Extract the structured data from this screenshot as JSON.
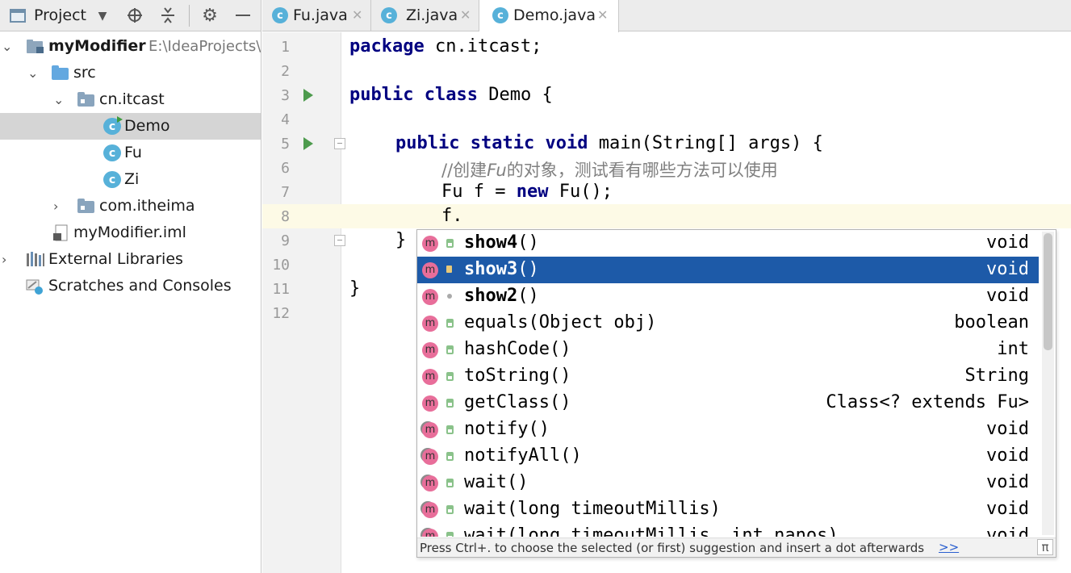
{
  "project_panel": {
    "title": "Project",
    "header_icons": [
      "project-view-icon",
      "dropdown-arrow-icon",
      "locate-icon",
      "collapse-icon",
      "gear-icon",
      "minimize-icon"
    ],
    "tree": {
      "root_name": "myModifier",
      "root_path": "E:\\IdeaProjects\\",
      "src": "src",
      "pkg1": "cn.itcast",
      "demo": "Demo",
      "fu": "Fu",
      "zi": "Zi",
      "pkg2": "com.itheima",
      "iml": "myModifier.iml",
      "external": "External Libraries",
      "scratches": "Scratches and Consoles"
    }
  },
  "editor_tabs": [
    {
      "label": "Fu.java",
      "active": false
    },
    {
      "label": "Zi.java",
      "active": false
    },
    {
      "label": "Demo.java",
      "active": true
    }
  ],
  "editor": {
    "line_numbers": [
      "1",
      "2",
      "3",
      "4",
      "5",
      "6",
      "7",
      "8",
      "9",
      "10",
      "11",
      "12"
    ],
    "caret_line": 8,
    "code": {
      "l1_kw": "package",
      "l1_rest": " cn.itcast;",
      "l3_kw1": "public",
      "l3_kw2": "class",
      "l3_rest": " Demo {",
      "l5_kw1": "public",
      "l5_kw2": "static",
      "l5_kw3": "void",
      "l5_rest": " main(String[] args) {",
      "l6_c1": "//创建",
      "l6_c2": "Fu",
      "l6_c3": "的对象，测试看有哪些方法可以使用",
      "l7_a": "Fu f = ",
      "l7_kw": "new",
      "l7_b": " Fu();",
      "l8": "f.",
      "l9": "}",
      "l11": "}"
    }
  },
  "completion": {
    "items": [
      {
        "bold": "show4",
        "rest": "()",
        "type": "void",
        "visibility": "public",
        "inherited": false
      },
      {
        "bold": "show3",
        "rest": "()",
        "type": "void",
        "visibility": "protected",
        "inherited": false
      },
      {
        "bold": "show2",
        "rest": "()",
        "type": "void",
        "visibility": "package",
        "inherited": false
      },
      {
        "bold": "",
        "rest": "equals(Object obj)",
        "type": "boolean",
        "visibility": "public",
        "inherited": false
      },
      {
        "bold": "",
        "rest": "hashCode()",
        "type": "int",
        "visibility": "public",
        "inherited": false
      },
      {
        "bold": "",
        "rest": "toString()",
        "type": "String",
        "visibility": "public",
        "inherited": false
      },
      {
        "bold": "",
        "rest": "getClass()",
        "type": "Class<? extends Fu>",
        "visibility": "public",
        "inherited": false
      },
      {
        "bold": "",
        "rest": "notify()",
        "type": "void",
        "visibility": "public",
        "inherited": true
      },
      {
        "bold": "",
        "rest": "notifyAll()",
        "type": "void",
        "visibility": "public",
        "inherited": true
      },
      {
        "bold": "",
        "rest": "wait()",
        "type": "void",
        "visibility": "public",
        "inherited": true
      },
      {
        "bold": "",
        "rest": "wait(long timeoutMillis)",
        "type": "void",
        "visibility": "public",
        "inherited": true
      },
      {
        "bold": "",
        "rest": "wait(long timeoutMillis, int nanos)",
        "type": "void",
        "visibility": "public",
        "inherited": true
      }
    ],
    "selected_index": 1,
    "method_icon_letter": "m",
    "hint": "Press Ctrl+. to choose the selected (or first) suggestion and insert a dot afterwards",
    "more_link": ">>",
    "pi_symbol": "π"
  },
  "colors": {
    "selection": "#1d5aa8",
    "keyword": "#000080",
    "comment": "#808080",
    "method_icon": "#e86e9a",
    "class_icon": "#57b1d9",
    "caret_line": "#fdfae6"
  }
}
